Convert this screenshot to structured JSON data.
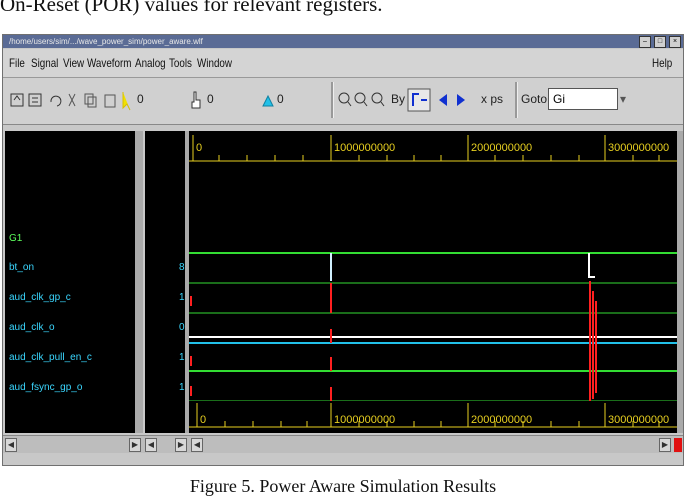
{
  "page": {
    "top_text": "On-Reset (POR) values for relevant registers.",
    "caption": "Figure 5.    Power Aware Simulation Results"
  },
  "window": {
    "title": "/home/users/sim/.../wave_power_sim/power_aware.wlf",
    "buttons": [
      "–",
      "□",
      "×"
    ]
  },
  "menu": {
    "items": [
      "File",
      "Signal",
      "View",
      "Waveform",
      "Analog",
      "Tools",
      "Window"
    ],
    "help": "Help"
  },
  "toolbar": {
    "cursor_a": "0",
    "cursor_b": "0",
    "cursor_c": "0",
    "by_label": "By",
    "units": "x ps",
    "goto_label": "Goto:",
    "goto_value": "Gi"
  },
  "signals": {
    "group": "G1",
    "names": [
      "bt_on",
      "aud_clk_gp_c",
      "aud_clk_o",
      "aud_clk_pull_en_c",
      "aud_fsync_gp_o"
    ],
    "values": [
      "8",
      "1",
      "0",
      "1",
      "1"
    ]
  },
  "timeline": {
    "top_ticks": [
      "0",
      "1000000000",
      "2000000000",
      "3000000000"
    ],
    "bottom_ticks": [
      "0",
      "1000000000",
      "2000000000",
      "3000000000"
    ]
  },
  "colors": {
    "waveform_bg": "#000000",
    "signal_green": "#33dd33",
    "transition_red": "#ff2020",
    "cursor_white": "#ffffff",
    "timeline_yellow": "#e8d020"
  }
}
